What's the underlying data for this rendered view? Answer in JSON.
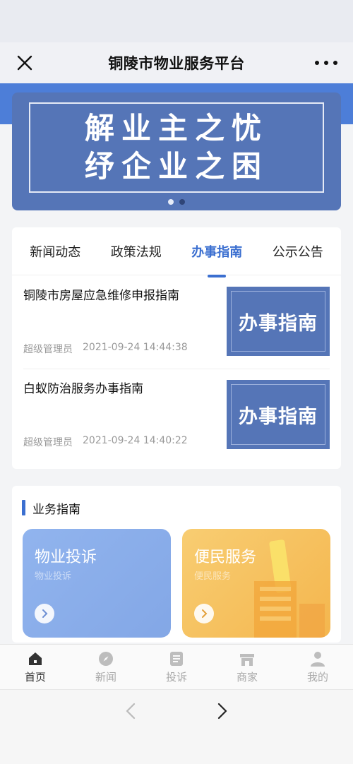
{
  "window": {
    "title": "铜陵市物业服务平台",
    "close_icon": "close-icon",
    "more_icon": "more-icon"
  },
  "banner": {
    "line1": "解业主之忧",
    "line2": "纾企业之困",
    "active_slide": 1,
    "slide_count": 2
  },
  "news": {
    "tabs": [
      {
        "label": "新闻动态",
        "active": false
      },
      {
        "label": "政策法规",
        "active": false
      },
      {
        "label": "办事指南",
        "active": true
      },
      {
        "label": "公示公告",
        "active": false
      }
    ],
    "items": [
      {
        "title": "铜陵市房屋应急维修申报指南",
        "author": "超级管理员",
        "time": "2021-09-24 14:44:38",
        "thumb_text": "办事指南"
      },
      {
        "title": "白蚁防治服务办事指南",
        "author": "超级管理员",
        "time": "2021-09-24 14:40:22",
        "thumb_text": "办事指南"
      }
    ]
  },
  "services": {
    "section_title": "业务指南",
    "tiles": [
      {
        "name": "物业投诉",
        "sub": "物业投诉",
        "color": "#8aaeea"
      },
      {
        "name": "便民服务",
        "sub": "便民服务",
        "color": "#f6c35f"
      }
    ]
  },
  "tabbar": {
    "items": [
      {
        "label": "首页",
        "icon": "home-icon",
        "active": true
      },
      {
        "label": "新闻",
        "icon": "compass-icon",
        "active": false
      },
      {
        "label": "投诉",
        "icon": "document-icon",
        "active": false
      },
      {
        "label": "商家",
        "icon": "store-icon",
        "active": false
      },
      {
        "label": "我的",
        "icon": "user-icon",
        "active": false
      }
    ]
  },
  "colors": {
    "accent": "#3b6fd0",
    "banner": "#5575b7",
    "hero": "#4d7ed8"
  }
}
